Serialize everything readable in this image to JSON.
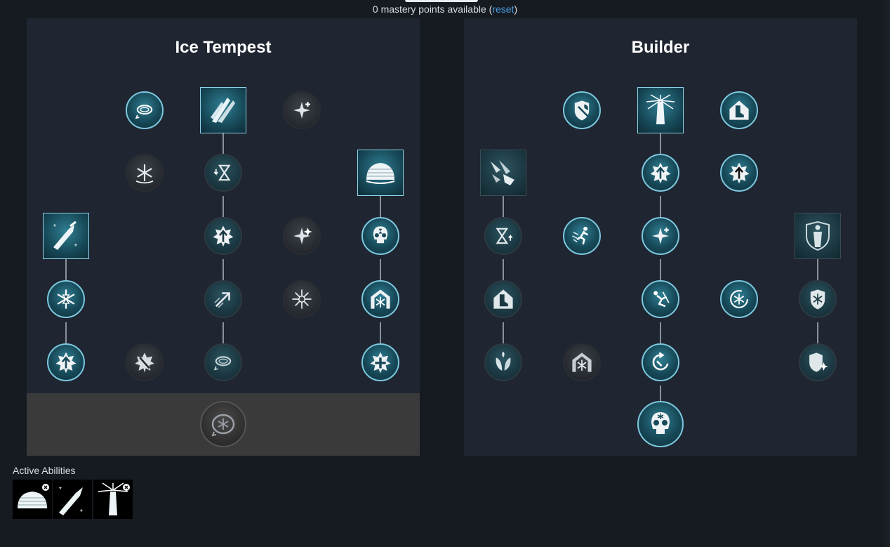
{
  "header": {
    "points_text": "0 mastery points available (",
    "reset_label": "reset",
    "points_close": ")"
  },
  "trees": [
    {
      "title": "Ice Tempest",
      "nodes": [
        {
          "icon": "orbit-ring-icon",
          "state": "active"
        },
        {
          "icon": "ice-shards-icon",
          "state": "active"
        },
        {
          "icon": "sparkle-plus-icon",
          "state": "inactive"
        },
        {
          "icon": "snowflake-icon",
          "state": "inactive"
        },
        {
          "icon": "hourglass-down-icon",
          "state": "dim"
        },
        {
          "icon": "ice-dome-icon",
          "state": "active"
        },
        {
          "icon": "ice-gauntlet-icon",
          "state": "active"
        },
        {
          "icon": "burst-up-arrow-icon",
          "state": "dim"
        },
        {
          "icon": "double-sparkle-icon",
          "state": "inactive"
        },
        {
          "icon": "skull-hourglass-icon",
          "state": "active"
        },
        {
          "icon": "snowflake-hourglass-icon",
          "state": "active"
        },
        {
          "icon": "arrow-up-right-icon",
          "state": "dim"
        },
        {
          "icon": "frost-star-icon",
          "state": "inactive"
        },
        {
          "icon": "snowflake-shelter-icon",
          "state": "active"
        },
        {
          "icon": "burst-up-arrow-icon",
          "state": "active"
        },
        {
          "icon": "snowflake-slash-icon",
          "state": "inactive"
        },
        {
          "icon": "orbit-down-icon",
          "state": "dim"
        },
        {
          "icon": "burst-cross-icon",
          "state": "active"
        },
        {
          "icon": "orbit-snowflake-icon",
          "state": "ult"
        }
      ]
    },
    {
      "title": "Builder",
      "nodes": [
        {
          "icon": "shield-axe-icon",
          "state": "active"
        },
        {
          "icon": "light-pillar-icon",
          "state": "active"
        },
        {
          "icon": "boot-house-icon",
          "state": "active"
        },
        {
          "icon": "falling-debris-icon",
          "state": "dim"
        },
        {
          "icon": "burst-up-arrow-icon",
          "state": "active"
        },
        {
          "icon": "burst-up-arrow-icon",
          "state": "active"
        },
        {
          "icon": "hourglass-up-icon",
          "state": "dim"
        },
        {
          "icon": "running-figure-icon",
          "state": "active"
        },
        {
          "icon": "sparkle-plus-icon",
          "state": "active"
        },
        {
          "icon": "frozen-figure-shield-icon",
          "state": "dim"
        },
        {
          "icon": "boot-house-icon",
          "state": "dim"
        },
        {
          "icon": "sliding-figure-icon",
          "state": "active"
        },
        {
          "icon": "snowflake-cycle-icon",
          "state": "active"
        },
        {
          "icon": "snowflake-shield-icon",
          "state": "dim"
        },
        {
          "icon": "leaves-icon",
          "state": "dim"
        },
        {
          "icon": "snowflake-shelter-icon",
          "state": "inactive"
        },
        {
          "icon": "cycle-arrow-icon",
          "state": "active"
        },
        {
          "icon": "shield-sparkle-icon",
          "state": "dim"
        },
        {
          "icon": "skull-snowflake-icon",
          "state": "ultactive"
        }
      ]
    }
  ],
  "active_abilities": {
    "label": "Active Abilities",
    "slots": [
      {
        "icon": "ice-dome-icon"
      },
      {
        "icon": "ice-gauntlet-icon"
      },
      {
        "icon": "light-pillar-icon"
      }
    ]
  },
  "colors": {
    "background": "#161b22",
    "panel": "#1f2631",
    "accent_link": "#4a9fe0",
    "active_border": "#7cc7de"
  }
}
